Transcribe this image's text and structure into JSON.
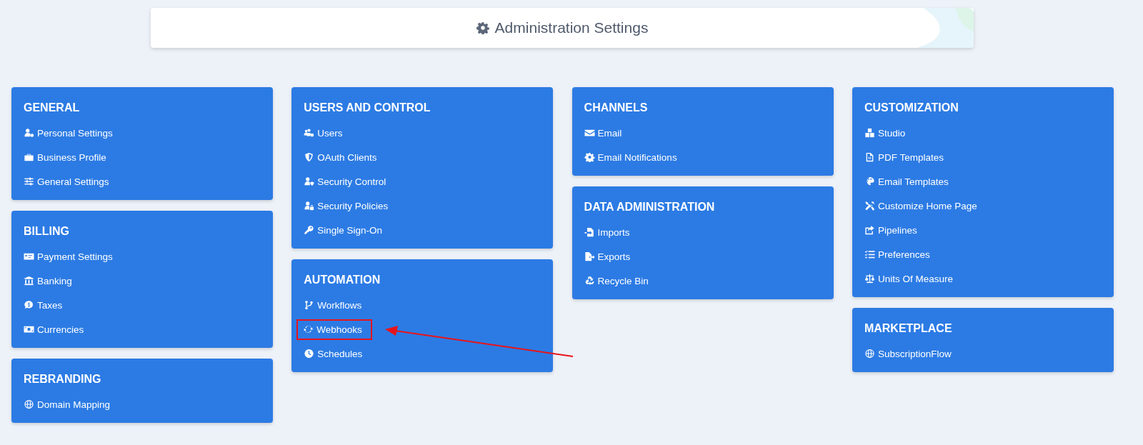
{
  "header": {
    "title": "Administration Settings"
  },
  "columns": [
    {
      "sections": [
        {
          "title": "GENERAL",
          "items": [
            {
              "label": "Personal Settings",
              "highlighted": false
            },
            {
              "label": "Business Profile",
              "highlighted": false
            },
            {
              "label": "General Settings",
              "highlighted": false
            }
          ]
        },
        {
          "title": "BILLING",
          "items": [
            {
              "label": "Payment Settings",
              "highlighted": false
            },
            {
              "label": "Banking",
              "highlighted": false
            },
            {
              "label": "Taxes",
              "highlighted": false
            },
            {
              "label": "Currencies",
              "highlighted": false
            }
          ]
        },
        {
          "title": "REBRANDING",
          "items": [
            {
              "label": "Domain Mapping",
              "highlighted": false
            }
          ]
        }
      ]
    },
    {
      "sections": [
        {
          "title": "USERS AND CONTROL",
          "items": [
            {
              "label": "Users",
              "highlighted": false
            },
            {
              "label": "OAuth Clients",
              "highlighted": false
            },
            {
              "label": "Security Control",
              "highlighted": false
            },
            {
              "label": "Security Policies",
              "highlighted": false
            },
            {
              "label": "Single Sign-On",
              "highlighted": false
            }
          ]
        },
        {
          "title": "AUTOMATION",
          "items": [
            {
              "label": "Workflows",
              "highlighted": false
            },
            {
              "label": "Webhooks",
              "highlighted": true
            },
            {
              "label": "Schedules",
              "highlighted": false
            }
          ]
        }
      ]
    },
    {
      "sections": [
        {
          "title": "CHANNELS",
          "items": [
            {
              "label": "Email",
              "highlighted": false
            },
            {
              "label": "Email Notifications",
              "highlighted": false
            }
          ]
        },
        {
          "title": "DATA ADMINISTRATION",
          "items": [
            {
              "label": "Imports",
              "highlighted": false
            },
            {
              "label": "Exports",
              "highlighted": false
            },
            {
              "label": "Recycle Bin",
              "highlighted": false
            }
          ]
        }
      ]
    },
    {
      "sections": [
        {
          "title": "CUSTOMIZATION",
          "items": [
            {
              "label": "Studio",
              "highlighted": false
            },
            {
              "label": "PDF Templates",
              "highlighted": false
            },
            {
              "label": "Email Templates",
              "highlighted": false
            },
            {
              "label": "Customize Home Page",
              "highlighted": false
            },
            {
              "label": "Pipelines",
              "highlighted": false
            },
            {
              "label": "Preferences",
              "highlighted": false
            },
            {
              "label": "Units Of Measure",
              "highlighted": false
            }
          ]
        },
        {
          "title": "MARKETPLACE",
          "items": [
            {
              "label": "SubscriptionFlow",
              "highlighted": false
            }
          ]
        }
      ]
    }
  ]
}
